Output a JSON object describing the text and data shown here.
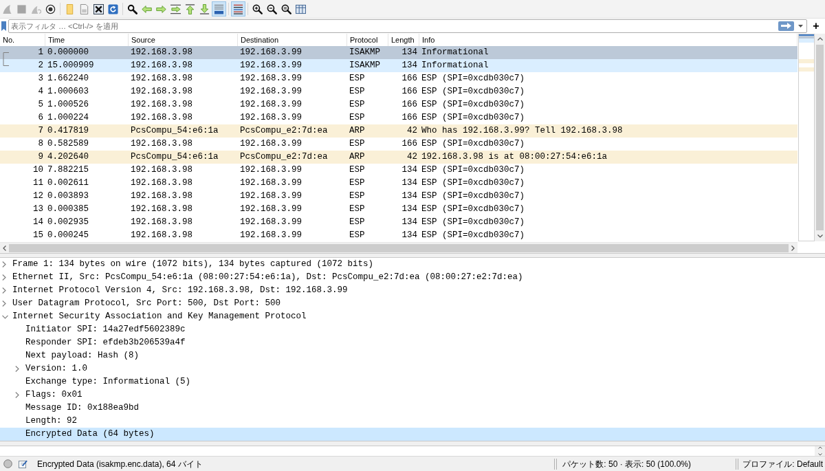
{
  "toolbar": [
    {
      "kind": "fin",
      "disabled": true,
      "on": false
    },
    {
      "kind": "stop",
      "disabled": true,
      "on": false
    },
    {
      "kind": "restart",
      "disabled": true,
      "on": false
    },
    {
      "kind": "options",
      "disabled": false,
      "on": false
    },
    {
      "kind": "separator"
    },
    {
      "kind": "open",
      "disabled": false,
      "on": false
    },
    {
      "kind": "save",
      "disabled": false,
      "on": false
    },
    {
      "kind": "close",
      "disabled": false,
      "on": false
    },
    {
      "kind": "reload",
      "disabled": false,
      "on": false
    },
    {
      "kind": "separator"
    },
    {
      "kind": "find",
      "disabled": false,
      "on": false
    },
    {
      "kind": "back",
      "disabled": false,
      "on": false
    },
    {
      "kind": "forward",
      "disabled": false,
      "on": false
    },
    {
      "kind": "goto",
      "disabled": false,
      "on": false
    },
    {
      "kind": "first",
      "disabled": false,
      "on": false
    },
    {
      "kind": "last",
      "disabled": false,
      "on": false
    },
    {
      "kind": "autoscroll",
      "disabled": false,
      "on": true
    },
    {
      "kind": "separator"
    },
    {
      "kind": "colorize",
      "disabled": false,
      "on": true
    },
    {
      "kind": "separator"
    },
    {
      "kind": "zoomin",
      "disabled": false,
      "on": false
    },
    {
      "kind": "zoomout",
      "disabled": false,
      "on": false
    },
    {
      "kind": "zoomreset",
      "disabled": false,
      "on": false
    },
    {
      "kind": "resize",
      "disabled": false,
      "on": false
    }
  ],
  "display_filter": {
    "placeholder": "表示フィルタ … <Ctrl-/> を適用",
    "add_button": "+"
  },
  "packet_list": {
    "columns": [
      "No.",
      "Time",
      "Source",
      "Destination",
      "Protocol",
      "Length",
      "Info"
    ],
    "rows": [
      {
        "no": "1",
        "time": "0.000000",
        "source": "192.168.3.98",
        "destination": "192.168.3.99",
        "protocol": "ISAKMP",
        "length": "134",
        "info": "Informational",
        "selected": true,
        "related": true
      },
      {
        "no": "2",
        "time": "15.000909",
        "source": "192.168.3.98",
        "destination": "192.168.3.99",
        "protocol": "ISAKMP",
        "length": "134",
        "info": "Informational",
        "color": "#daeeff",
        "selected": false,
        "related": true
      },
      {
        "no": "3",
        "time": "1.662240",
        "source": "192.168.3.98",
        "destination": "192.168.3.99",
        "protocol": "ESP",
        "length": "166",
        "info": "ESP (SPI=0xcdb030c7)",
        "color": "#ffffff",
        "selected": false,
        "related": false
      },
      {
        "no": "4",
        "time": "1.000603",
        "source": "192.168.3.98",
        "destination": "192.168.3.99",
        "protocol": "ESP",
        "length": "166",
        "info": "ESP (SPI=0xcdb030c7)",
        "color": "#ffffff",
        "selected": false,
        "related": false
      },
      {
        "no": "5",
        "time": "1.000526",
        "source": "192.168.3.98",
        "destination": "192.168.3.99",
        "protocol": "ESP",
        "length": "166",
        "info": "ESP (SPI=0xcdb030c7)",
        "color": "#ffffff",
        "selected": false,
        "related": false
      },
      {
        "no": "6",
        "time": "1.000224",
        "source": "192.168.3.98",
        "destination": "192.168.3.99",
        "protocol": "ESP",
        "length": "166",
        "info": "ESP (SPI=0xcdb030c7)",
        "color": "#ffffff",
        "selected": false,
        "related": false
      },
      {
        "no": "7",
        "time": "0.417819",
        "source": "PcsCompu_54:e6:1a",
        "destination": "PcsCompu_e2:7d:ea",
        "protocol": "ARP",
        "length": "42",
        "info": "Who has 192.168.3.99? Tell 192.168.3.98",
        "color": "#faf0d7",
        "selected": false,
        "related": false
      },
      {
        "no": "8",
        "time": "0.582589",
        "source": "192.168.3.98",
        "destination": "192.168.3.99",
        "protocol": "ESP",
        "length": "166",
        "info": "ESP (SPI=0xcdb030c7)",
        "color": "#ffffff",
        "selected": false,
        "related": false
      },
      {
        "no": "9",
        "time": "4.202640",
        "source": "PcsCompu_54:e6:1a",
        "destination": "PcsCompu_e2:7d:ea",
        "protocol": "ARP",
        "length": "42",
        "info": "192.168.3.98 is at 08:00:27:54:e6:1a",
        "color": "#faf0d7",
        "selected": false,
        "related": false
      },
      {
        "no": "10",
        "time": "7.882215",
        "source": "192.168.3.98",
        "destination": "192.168.3.99",
        "protocol": "ESP",
        "length": "134",
        "info": "ESP (SPI=0xcdb030c7)",
        "color": "#ffffff",
        "selected": false,
        "related": false
      },
      {
        "no": "11",
        "time": "0.002611",
        "source": "192.168.3.98",
        "destination": "192.168.3.99",
        "protocol": "ESP",
        "length": "134",
        "info": "ESP (SPI=0xcdb030c7)",
        "color": "#ffffff",
        "selected": false,
        "related": false
      },
      {
        "no": "12",
        "time": "0.003893",
        "source": "192.168.3.98",
        "destination": "192.168.3.99",
        "protocol": "ESP",
        "length": "134",
        "info": "ESP (SPI=0xcdb030c7)",
        "color": "#ffffff",
        "selected": false,
        "related": false
      },
      {
        "no": "13",
        "time": "0.000385",
        "source": "192.168.3.98",
        "destination": "192.168.3.99",
        "protocol": "ESP",
        "length": "134",
        "info": "ESP (SPI=0xcdb030c7)",
        "color": "#ffffff",
        "selected": false,
        "related": false
      },
      {
        "no": "14",
        "time": "0.002935",
        "source": "192.168.3.98",
        "destination": "192.168.3.99",
        "protocol": "ESP",
        "length": "134",
        "info": "ESP (SPI=0xcdb030c7)",
        "color": "#ffffff",
        "selected": false,
        "related": false
      },
      {
        "no": "15",
        "time": "0.000245",
        "source": "192.168.3.98",
        "destination": "192.168.3.99",
        "protocol": "ESP",
        "length": "134",
        "info": "ESP (SPI=0xcdb030c7)",
        "color": "#ffffff",
        "selected": false,
        "related": false
      }
    ]
  },
  "packet_details": [
    {
      "text": "Frame 1: 134 bytes on wire (1072 bits), 134 bytes captured (1072 bits)",
      "kind": "branch",
      "expanded": false,
      "selected": false
    },
    {
      "text": "Ethernet II, Src: PcsCompu_54:e6:1a (08:00:27:54:e6:1a), Dst: PcsCompu_e2:7d:ea (08:00:27:e2:7d:ea)",
      "kind": "branch",
      "expanded": false,
      "selected": false
    },
    {
      "text": "Internet Protocol Version 4, Src: 192.168.3.98, Dst: 192.168.3.99",
      "kind": "branch",
      "expanded": false,
      "selected": false
    },
    {
      "text": "User Datagram Protocol, Src Port: 500, Dst Port: 500",
      "kind": "branch",
      "expanded": false,
      "selected": false
    },
    {
      "text": "Internet Security Association and Key Management Protocol",
      "kind": "branch",
      "expanded": true,
      "selected": false,
      "children": [
        {
          "text": "Initiator SPI: 14a27edf5602389c",
          "kind": "leaf",
          "selected": false
        },
        {
          "text": "Responder SPI: efdeb3b206539a4f",
          "kind": "leaf",
          "selected": false
        },
        {
          "text": "Next payload: Hash (8)",
          "kind": "leaf",
          "selected": false
        },
        {
          "text": "Version: 1.0",
          "kind": "branch",
          "expanded": false,
          "selected": false
        },
        {
          "text": "Exchange type: Informational (5)",
          "kind": "leaf",
          "selected": false
        },
        {
          "text": "Flags: 0x01",
          "kind": "branch",
          "expanded": false,
          "selected": false
        },
        {
          "text": "Message ID: 0x188ea9bd",
          "kind": "leaf",
          "selected": false
        },
        {
          "text": "Length: 92",
          "kind": "leaf",
          "selected": false
        },
        {
          "text": "Encrypted Data (64 bytes)",
          "kind": "leaf",
          "selected": true
        }
      ]
    }
  ],
  "status_bar": {
    "field_info": "Encrypted Data (isakmp.enc.data), 64 バイト",
    "packets": "パケット数: 50 · 表示: 50 (100.0%)",
    "profile": "プロファイル: Default"
  }
}
